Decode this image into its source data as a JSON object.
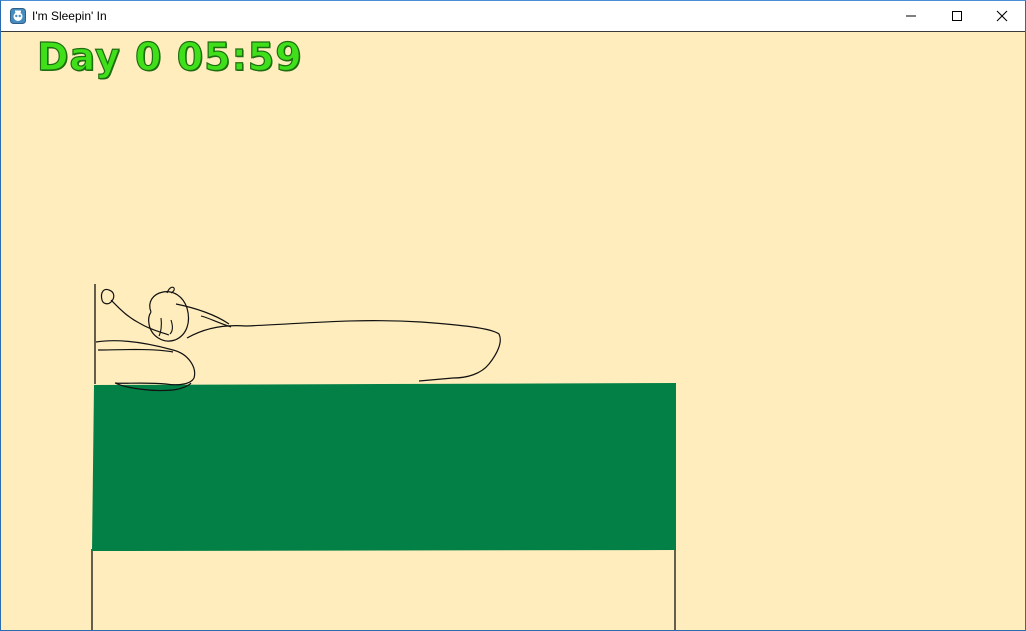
{
  "window": {
    "title": "I'm Sleepin' In",
    "controls": {
      "minimize": "minimize-icon",
      "maximize": "maximize-icon",
      "close": "close-icon"
    }
  },
  "hud": {
    "day": "Day 0",
    "time": "05:59"
  },
  "colors": {
    "background": "#ffedbd",
    "mattress": "#038045",
    "clock_fill": "#3fe01a",
    "clock_outline": "#1f6e12"
  }
}
